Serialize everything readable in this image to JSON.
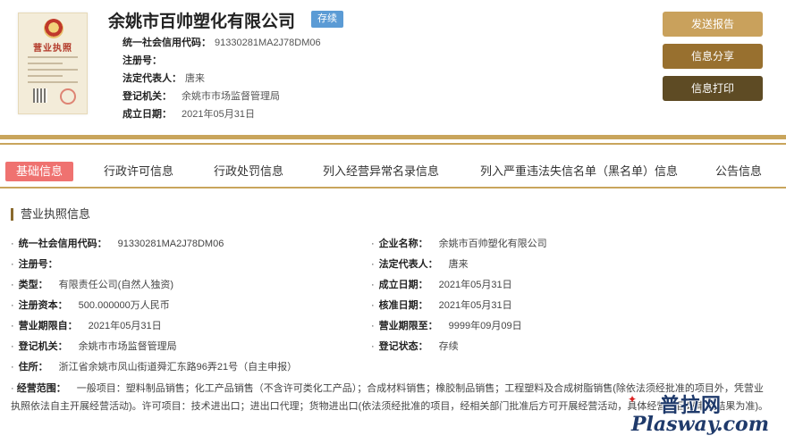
{
  "header": {
    "company_name": "余姚市百帅塑化有限公司",
    "status": "存续",
    "license_image": {
      "title": "营业执照"
    },
    "info": [
      {
        "label": "统一社会信用代码：",
        "value": "91330281MA2J78DM06"
      },
      {
        "label": "注册号：",
        "value": ""
      },
      {
        "label": "法定代表人：",
        "value": "唐来"
      },
      {
        "label": "登记机关：",
        "value": "余姚市市场监督管理局"
      },
      {
        "label": "成立日期：",
        "value": "2021年05月31日"
      }
    ]
  },
  "actions": {
    "send_report": "发送报告",
    "share": "信息分享",
    "print": "信息打印"
  },
  "tabs": [
    {
      "label": "基础信息",
      "active": true
    },
    {
      "label": "行政许可信息",
      "active": false
    },
    {
      "label": "行政处罚信息",
      "active": false
    },
    {
      "label": "列入经营异常名录信息",
      "active": false
    },
    {
      "label": "列入严重违法失信名单（黑名单）信息",
      "active": false
    },
    {
      "label": "公告信息",
      "active": false
    }
  ],
  "section": {
    "title": "营业执照信息",
    "bullet": "·",
    "fields": [
      {
        "label": "统一社会信用代码：",
        "value": "91330281MA2J78DM06"
      },
      {
        "label": "企业名称：",
        "value": "余姚市百帅塑化有限公司"
      },
      {
        "label": "注册号：",
        "value": ""
      },
      {
        "label": "法定代表人：",
        "value": "唐来"
      },
      {
        "label": "类型：",
        "value": "有限责任公司(自然人独资)"
      },
      {
        "label": "成立日期：",
        "value": "2021年05月31日"
      },
      {
        "label": "注册资本：",
        "value": "500.000000万人民币"
      },
      {
        "label": "核准日期：",
        "value": "2021年05月31日"
      },
      {
        "label": "营业期限自：",
        "value": "2021年05月31日"
      },
      {
        "label": "营业期限至：",
        "value": "9999年09月09日"
      },
      {
        "label": "登记机关：",
        "value": "余姚市市场监督管理局"
      },
      {
        "label": "登记状态：",
        "value": "存续"
      },
      {
        "label": "住所：",
        "value": "浙江省余姚市凤山街道舜汇东路96弄21号（自主申报）"
      }
    ],
    "scope": {
      "label": "经营范围：",
      "value": "一般项目：塑料制品销售；化工产品销售（不含许可类化工产品）；合成材料销售；橡胶制品销售；工程塑料及合成树脂销售(除依法须经批准的项目外，凭营业执照依法自主开展经营活动)。许可项目：技术进出口；进出口代理；货物进出口(依法须经批准的项目，经相关部门批准后方可开展经营活动，具体经营项目以审批结果为准)。"
    }
  },
  "watermark": {
    "top": "普拉网",
    "bottom": "Plasway.com"
  },
  "colors": {
    "gold": "#c9a55c",
    "tab_active": "#ef7270",
    "status_tag": "#5b9bd5"
  }
}
